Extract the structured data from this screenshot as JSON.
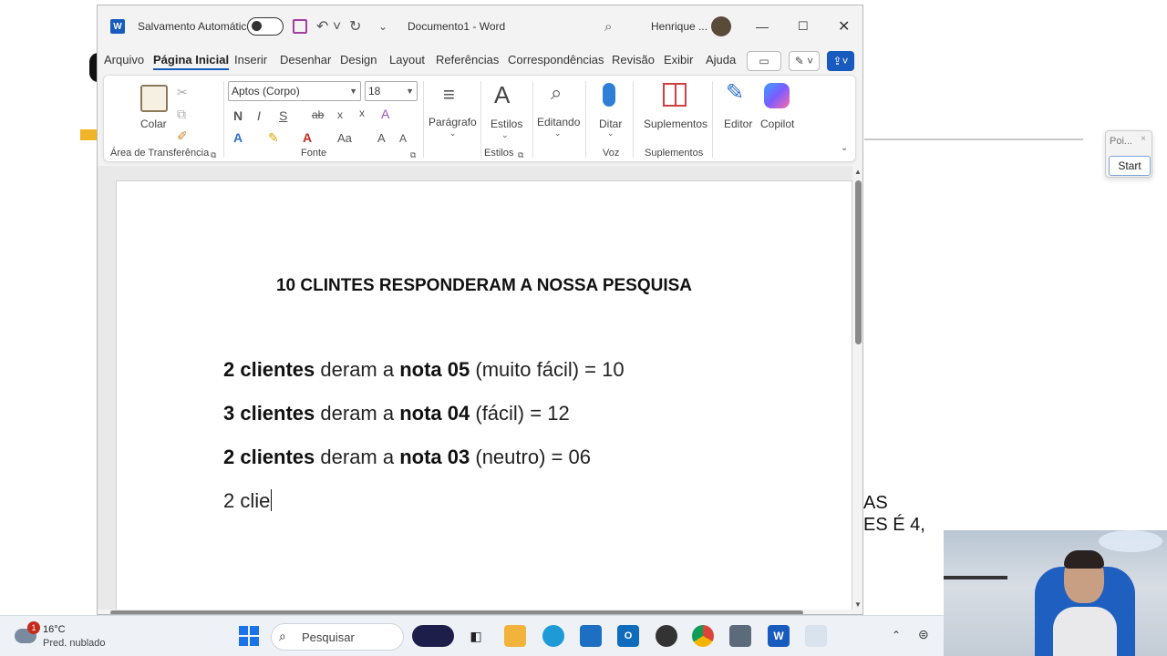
{
  "word": {
    "autosave_label": "Salvamento Automático",
    "doc_title": "Documento1  -  Word",
    "user_name": "Henrique ...",
    "tabs": [
      "Arquivo",
      "Página Inicial",
      "Inserir",
      "Desenhar",
      "Design",
      "Layout",
      "Referências",
      "Correspondências",
      "Revisão",
      "Exibir",
      "Ajuda"
    ],
    "active_tab": "Página Inicial",
    "ribbon": {
      "paste_label": "Colar",
      "clipboard_group": "Área de Transferência",
      "font_name": "Aptos (Corpo)",
      "font_size": "18",
      "font_group": "Fonte",
      "bold": "N",
      "italic": "I",
      "underline": "S",
      "strike": "ab",
      "subscript": "x",
      "superscript": "x",
      "change_case": "Aa",
      "grow": "A",
      "shrink": "A",
      "paragraph_label": "Parágrafo",
      "styles_label": "Estilos",
      "styles_group": "Estilos",
      "editing_label": "Editando",
      "dictate_label": "Ditar",
      "voice_group": "Voz",
      "addins_label": "Suplementos",
      "addins_group": "Suplementos",
      "editor_label": "Editor",
      "copilot_label": "Copilot"
    },
    "document": {
      "title": "10 CLINTES RESPONDERAM A NOSSA PESQUISA",
      "lines": [
        {
          "bold1": "2 clientes",
          "mid": " deram a ",
          "bold2": "nota 05",
          "rest": " (muito fácil) = 10"
        },
        {
          "bold1": "3 clientes",
          "mid": " deram a ",
          "bold2": "nota 04",
          "rest": " (fácil) = 12"
        },
        {
          "bold1": "2 clientes",
          "mid": " deram a ",
          "bold2": "nota 03",
          "rest": " (neutro) = 06"
        }
      ],
      "typing": "2 clie"
    }
  },
  "background": {
    "text_line1": "AS",
    "text_line2": "ES É 4,",
    "widget_title": "Poi...",
    "widget_close": "×",
    "widget_button": "Start"
  },
  "taskbar": {
    "weather_badge": "1",
    "temperature": "16°C",
    "weather_desc": "Pred. nublado",
    "search_placeholder": "Pesquisar"
  },
  "colors": {
    "word_blue": "#185abd",
    "taskbar_bg": "#eef2f7",
    "ribbon_bg": "#ffffff"
  }
}
